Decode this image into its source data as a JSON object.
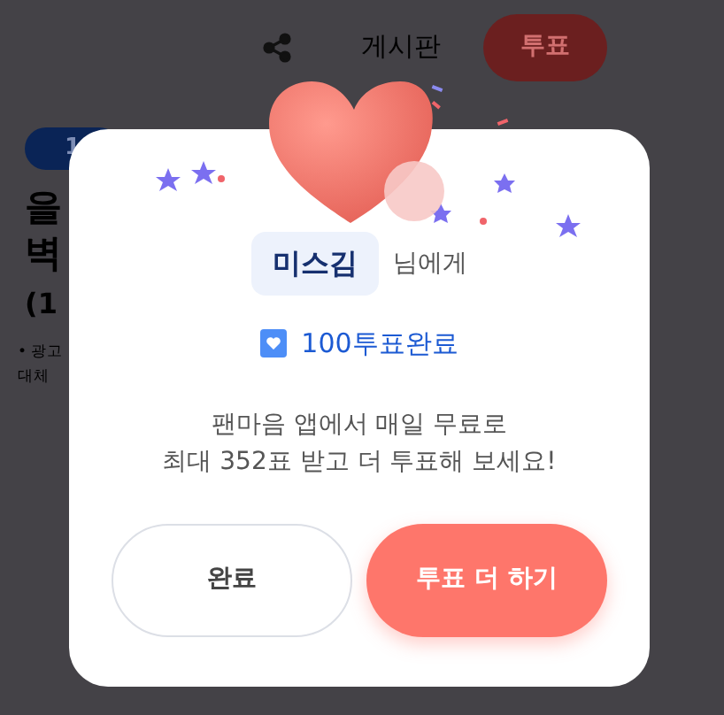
{
  "background": {
    "board_tab": "게시판",
    "vote_button": "투표",
    "badge": "1",
    "headline_lines": [
      "을",
      "벽"
    ],
    "subtitle": "(1",
    "notes": [
      "• 광고",
      "대체"
    ]
  },
  "dialog": {
    "recipient": "미스김",
    "recipient_suffix": "님에게",
    "votes_done": "100투표완료",
    "message": [
      "팬마음 앱에서 매일 무료로",
      "최대 352표 받고 더 투표해 보세요!"
    ],
    "buttons": [
      {
        "label": "완료",
        "kind": "secondary"
      },
      {
        "label": "투표 더 하기",
        "kind": "primary"
      }
    ]
  }
}
